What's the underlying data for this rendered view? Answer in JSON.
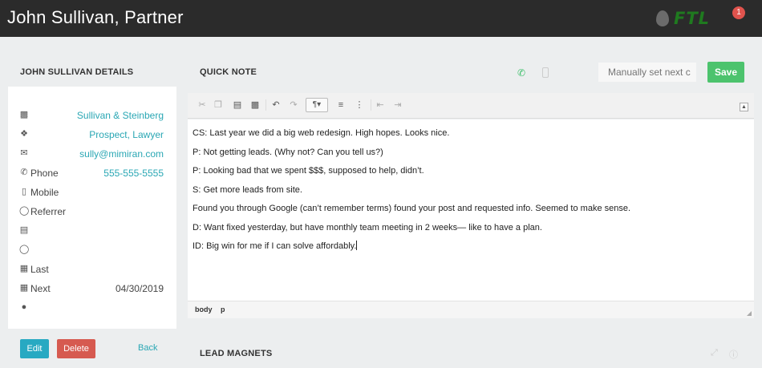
{
  "header": {
    "title": "John Sullivan, Partner",
    "logo_text": "FTL",
    "notification_count": "1"
  },
  "details": {
    "heading": "JOHN SULLIVAN DETAILS",
    "rows": [
      {
        "icon": "building-icon",
        "label": "",
        "value": "Sullivan & Steinberg"
      },
      {
        "icon": "tags-icon",
        "label": "",
        "value": "Prospect, Lawyer"
      },
      {
        "icon": "envelope-icon",
        "label": "",
        "value": "sully@mimiran.com"
      },
      {
        "icon": "phone-icon",
        "label": "Phone",
        "value": "555-555-5555"
      },
      {
        "icon": "mobile-icon",
        "label": "Mobile",
        "value": ""
      },
      {
        "icon": "user-icon",
        "label": "Referrer",
        "value": ""
      },
      {
        "icon": "document-icon",
        "label": "",
        "value": ""
      },
      {
        "icon": "user-outline-icon",
        "label": "",
        "value": ""
      },
      {
        "icon": "calendar-icon",
        "label": "Last",
        "value": ""
      },
      {
        "icon": "calendar-icon",
        "label": "Next",
        "value": "04/30/2019"
      },
      {
        "icon": "user-solid-icon",
        "label": "",
        "value": ""
      }
    ],
    "edit_label": "Edit",
    "delete_label": "Delete",
    "back_label": "Back"
  },
  "quick_note": {
    "heading": "QUICK NOTE",
    "next_placeholder": "Manually set next c",
    "save_label": "Save",
    "lines": [
      "CS: Last year we did a big web redesign. High hopes. Looks nice.",
      "P: Not getting leads. (Why not? Can you tell us?)",
      "P: Looking bad that we spent $$$, supposed to help, didn’t.",
      "S: Get more leads from site.",
      "Found you through Google (can’t remember terms) found your post and requested info. Seemed to make sense.",
      "D: Want fixed yesterday, but have monthly team meeting in 2 weeks— like to have a plan.",
      "ID: Big win for me if I can solve affordably."
    ],
    "path": [
      "body",
      "p"
    ]
  },
  "lead_magnets": {
    "heading": "LEAD MAGNETS"
  }
}
